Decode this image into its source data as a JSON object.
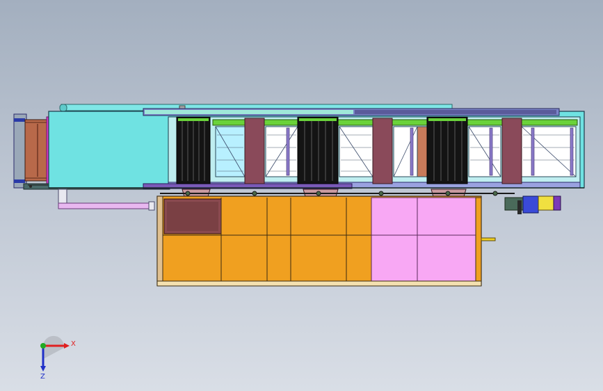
{
  "triad": {
    "x_label": "X",
    "z_label": "Z",
    "x_color": "#e02020",
    "z_color": "#2030c8",
    "y_color": "#22aa22"
  },
  "colors": {
    "background_top": "#a3afbf",
    "background_bottom": "#d9dee6",
    "conveyor_brown": "#b8694a",
    "frame_cyan": "#6fe2e2",
    "frame_green": "#6ad23a",
    "brush_black": "#141414",
    "tank_orange": "#f0a020",
    "tank_pink": "#f8a8f4",
    "panel_maroon": "#8a4a5a",
    "motor_blue": "#3a4ad8",
    "motor_purple": "#7a3ab8"
  }
}
